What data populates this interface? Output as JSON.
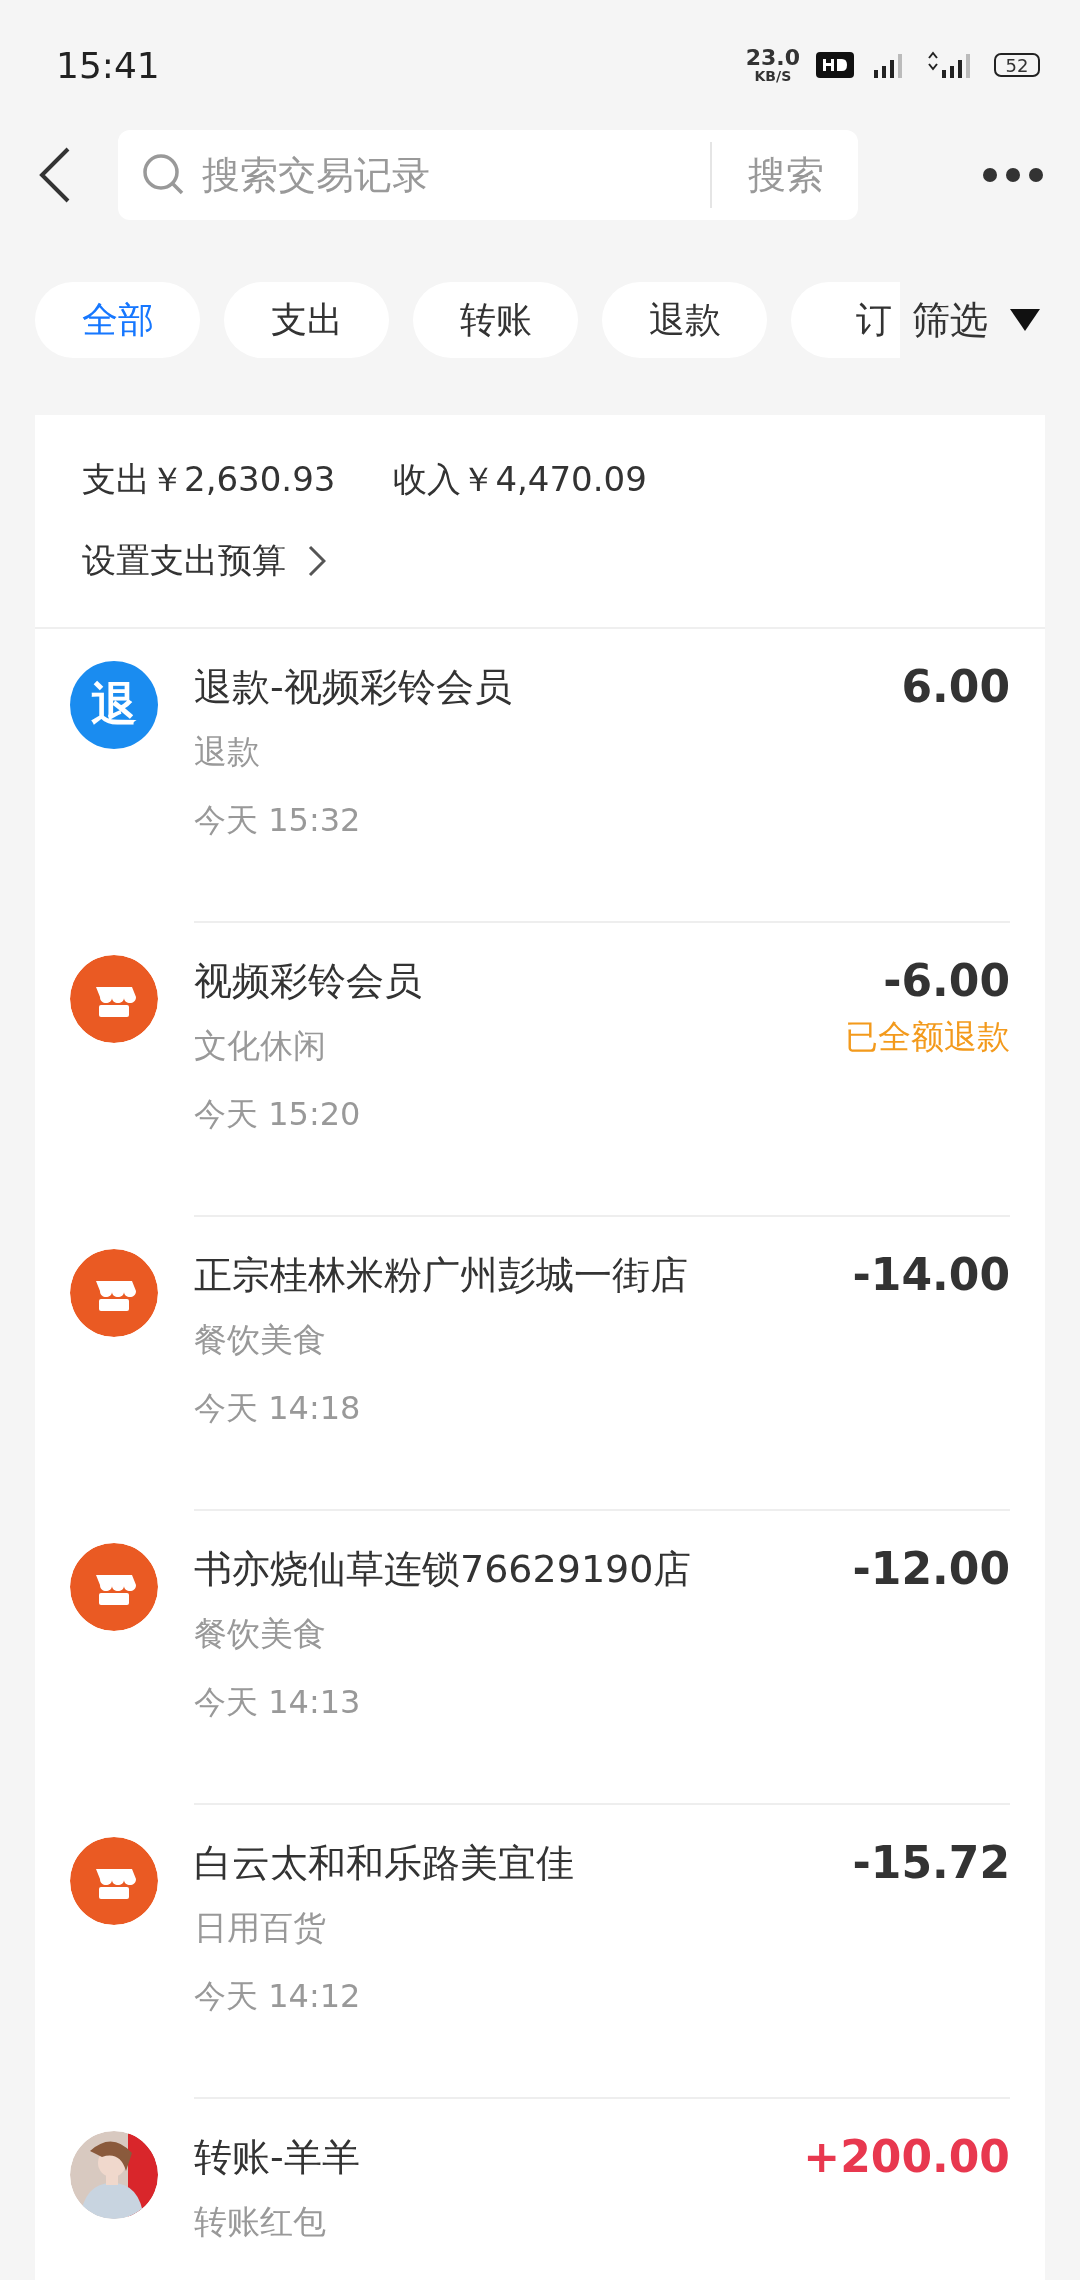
{
  "status_bar": {
    "time": "15:41",
    "speed": "23.0",
    "speed_unit": "KB/S",
    "battery": "52"
  },
  "search": {
    "placeholder": "搜索交易记录",
    "button": "搜索"
  },
  "tabs": [
    {
      "label": "全部",
      "selected": true
    },
    {
      "label": "支出",
      "selected": false
    },
    {
      "label": "转账",
      "selected": false
    },
    {
      "label": "退款",
      "selected": false
    },
    {
      "label": "订",
      "selected": false
    }
  ],
  "filter": {
    "label": "筛选"
  },
  "summary": {
    "expense": "支出￥2,630.93",
    "income": "收入￥4,470.09",
    "budget_link": "设置支出预算"
  },
  "transactions": [
    {
      "kind": "refund",
      "icon_text": "退",
      "title": "退款-视频彩铃会员",
      "category": "退款",
      "time": "今天 15:32",
      "amount": "6.00",
      "positive": false
    },
    {
      "kind": "store",
      "title": "视频彩铃会员",
      "category": "文化休闲",
      "time": "今天 15:20",
      "amount": "-6.00",
      "positive": false,
      "status": "已全额退款"
    },
    {
      "kind": "store",
      "title": "正宗桂林米粉广州彭城一街店",
      "category": "餐饮美食",
      "time": "今天 14:18",
      "amount": "-14.00",
      "positive": false
    },
    {
      "kind": "store",
      "title": "书亦烧仙草连锁76629190店",
      "category": "餐饮美食",
      "time": "今天 14:13",
      "amount": "-12.00",
      "positive": false
    },
    {
      "kind": "store",
      "title": "白云太和和乐路美宜佳",
      "category": "日用百货",
      "time": "今天 14:12",
      "amount": "-15.72",
      "positive": false
    },
    {
      "kind": "avatar",
      "title": "转账-羊羊",
      "category": "转账红包",
      "amount": "+200.00",
      "positive": true
    }
  ]
}
